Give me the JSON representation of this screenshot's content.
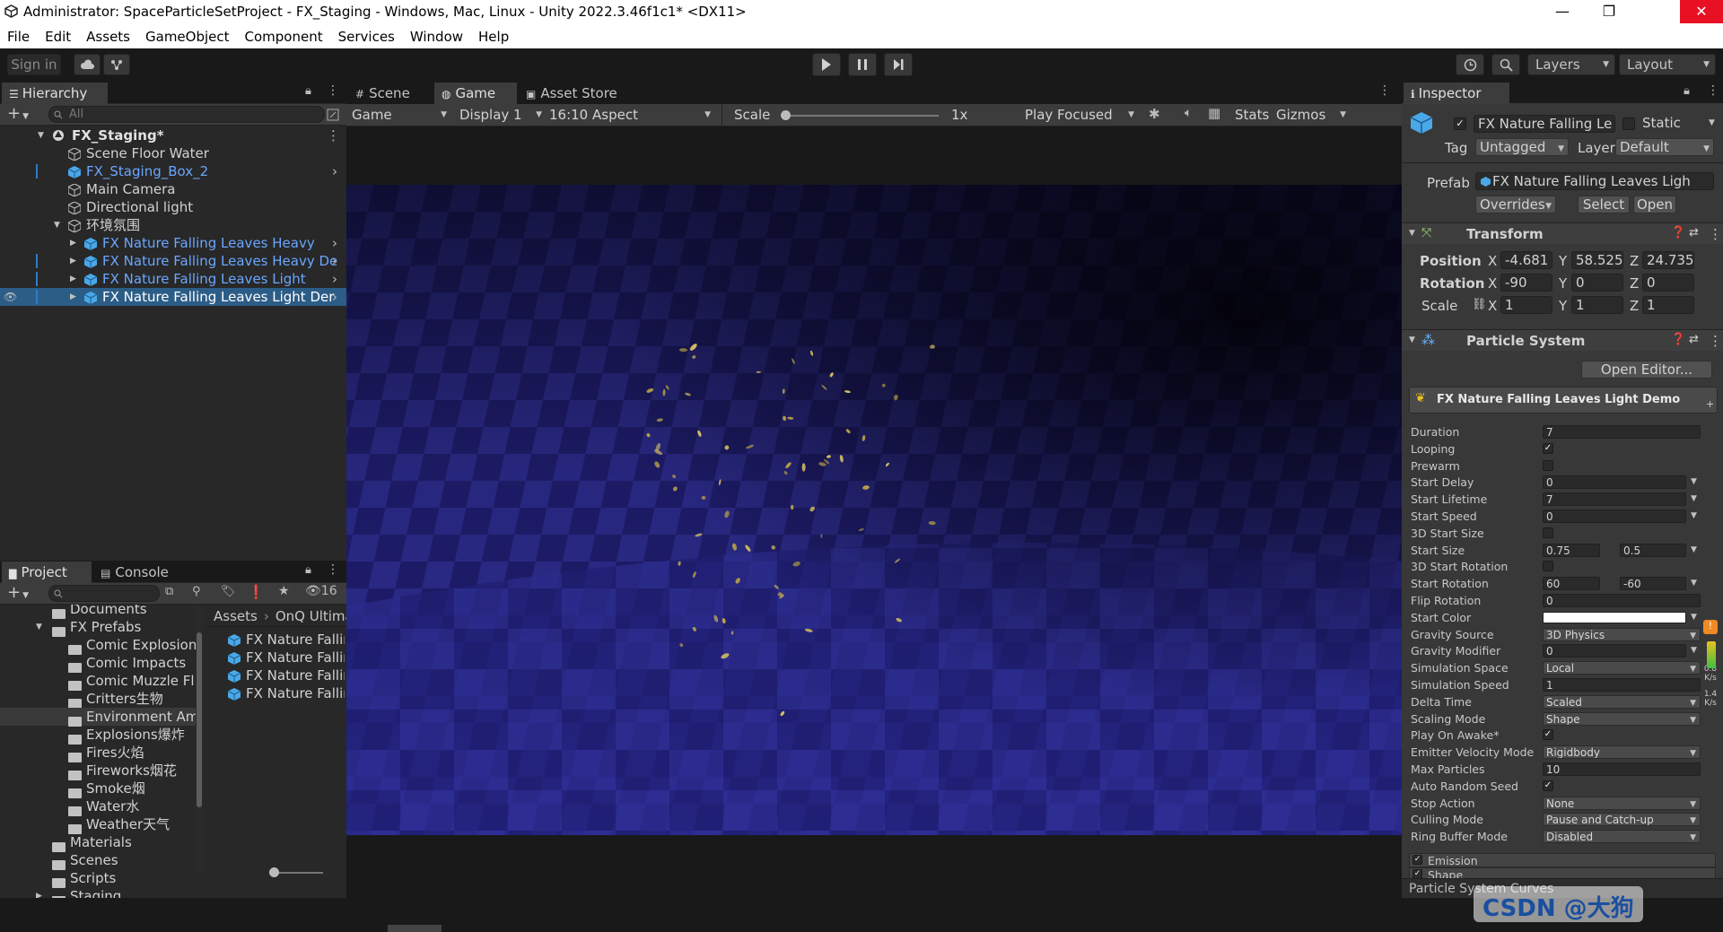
{
  "window": {
    "title": "Administrator: SpaceParticleSetProject - FX_Staging - Windows, Mac, Linux - Unity 2022.3.46f1c1* <DX11>",
    "controls": [
      "—",
      "❐",
      "✕"
    ]
  },
  "menu": [
    "File",
    "Edit",
    "Assets",
    "GameObject",
    "Component",
    "Services",
    "Window",
    "Help"
  ],
  "toolbar": {
    "sign_in": "Sign in",
    "layers": "Layers",
    "layout": "Layout"
  },
  "hierarchy": {
    "tab": "Hierarchy",
    "search_placeholder": "All",
    "scene": "FX_Staging*",
    "items": [
      {
        "label": "Scene Floor Water",
        "indent": 1
      },
      {
        "label": "FX_Staging_Box_2",
        "indent": 1
      },
      {
        "label": "Main Camera",
        "indent": 1
      },
      {
        "label": "Directional light",
        "indent": 1
      },
      {
        "label": "环境氛围",
        "indent": 1
      },
      {
        "label": "FX Nature Falling Leaves Heavy",
        "indent": 2
      },
      {
        "label": "FX Nature Falling Leaves Heavy De",
        "indent": 2
      },
      {
        "label": "FX Nature Falling Leaves Light",
        "indent": 2
      },
      {
        "label": "FX Nature Falling Leaves Light Der",
        "indent": 2
      }
    ]
  },
  "project": {
    "tabs": [
      "Project",
      "Console"
    ],
    "hidden_count": "16",
    "folders": [
      {
        "label": "Documents",
        "indent": 2
      },
      {
        "label": "FX Prefabs",
        "indent": 2
      },
      {
        "label": "Comic Explosion:",
        "indent": 3
      },
      {
        "label": "Comic Impacts",
        "indent": 3
      },
      {
        "label": "Comic Muzzle Fl",
        "indent": 3
      },
      {
        "label": "Critters生物",
        "indent": 3
      },
      {
        "label": "Environment Amt",
        "indent": 3
      },
      {
        "label": "Explosions爆炸",
        "indent": 3
      },
      {
        "label": "Fires火焰",
        "indent": 3
      },
      {
        "label": "Fireworks烟花",
        "indent": 3
      },
      {
        "label": "Smoke烟",
        "indent": 3
      },
      {
        "label": "Water水",
        "indent": 3
      },
      {
        "label": "Weather天气",
        "indent": 3
      },
      {
        "label": "Materials",
        "indent": 2
      },
      {
        "label": "Scenes",
        "indent": 2
      },
      {
        "label": "Scripts",
        "indent": 2
      },
      {
        "label": "Staging",
        "indent": 2
      }
    ],
    "breadcrumb": [
      "Assets",
      "OnQ Ultima"
    ],
    "assets": [
      "FX Nature Fallir",
      "FX Nature Fallir",
      "FX Nature Fallir",
      "FX Nature Fallir"
    ]
  },
  "center": {
    "tabs": [
      "Scene",
      "Game",
      "Asset Store"
    ],
    "game_dropdown": "Game",
    "display": "Display 1",
    "aspect": "16:10 Aspect",
    "scale_label": "Scale",
    "scale_value": "1x",
    "play_focused": "Play Focused",
    "stats": "Stats",
    "gizmos": "Gizmos"
  },
  "inspector": {
    "tab": "Inspector",
    "name": "FX Nature Falling Le",
    "static": "Static",
    "tag_label": "Tag",
    "tag": "Untagged",
    "layer_label": "Layer",
    "layer": "Default",
    "prefab_label": "Prefab",
    "prefab": "FX Nature Falling Leaves Ligh",
    "overrides": "Overrides",
    "select": "Select",
    "open": "Open",
    "transform": {
      "title": "Transform",
      "position": {
        "label": "Position",
        "x": "-4.681",
        "y": "58.525",
        "z": "24.735"
      },
      "rotation": {
        "label": "Rotation",
        "x": "-90",
        "y": "0",
        "z": "0"
      },
      "scale": {
        "label": "Scale",
        "x": "1",
        "y": "1",
        "z": "1"
      }
    },
    "particle": {
      "title": "Particle System",
      "open_editor": "Open Editor...",
      "system_name": "FX Nature Falling Leaves Light Demo",
      "props": [
        {
          "label": "Duration",
          "value": "7",
          "kind": "field"
        },
        {
          "label": "Looping",
          "value": "✓",
          "kind": "check"
        },
        {
          "label": "Prewarm",
          "value": "",
          "kind": "check"
        },
        {
          "label": "Start Delay",
          "value": "0",
          "kind": "fieldarrow"
        },
        {
          "label": "Start Lifetime",
          "value": "7",
          "kind": "fieldarrow"
        },
        {
          "label": "Start Speed",
          "value": "0",
          "kind": "fieldarrow"
        },
        {
          "label": "3D Start Size",
          "value": "",
          "kind": "check"
        },
        {
          "label": "Start Size",
          "value": "0.75",
          "value2": "0.5",
          "kind": "two"
        },
        {
          "label": "3D Start Rotation",
          "value": "",
          "kind": "check"
        },
        {
          "label": "Start Rotation",
          "value": "60",
          "value2": "-60",
          "kind": "two"
        },
        {
          "label": "Flip Rotation",
          "value": "0",
          "kind": "field"
        },
        {
          "label": "Start Color",
          "value": "",
          "kind": "color"
        },
        {
          "label": "Gravity Source",
          "value": "3D Physics",
          "kind": "drop"
        },
        {
          "label": "Gravity Modifier",
          "value": "0",
          "kind": "fieldarrow"
        },
        {
          "label": "Simulation Space",
          "value": "Local",
          "kind": "drop"
        },
        {
          "label": "Simulation Speed",
          "value": "1",
          "kind": "field"
        },
        {
          "label": "Delta Time",
          "value": "Scaled",
          "kind": "drop"
        },
        {
          "label": "Scaling Mode",
          "value": "Shape",
          "kind": "drop"
        },
        {
          "label": "Play On Awake*",
          "value": "✓",
          "kind": "check"
        },
        {
          "label": "Emitter Velocity Mode",
          "value": "Rigidbody",
          "kind": "drop"
        },
        {
          "label": "Max Particles",
          "value": "10",
          "kind": "field"
        },
        {
          "label": "Auto Random Seed",
          "value": "✓",
          "kind": "check"
        },
        {
          "label": "Stop Action",
          "value": "None",
          "kind": "drop"
        },
        {
          "label": "Culling Mode",
          "value": "Pause and Catch-up",
          "kind": "drop"
        },
        {
          "label": "Ring Buffer Mode",
          "value": "Disabled",
          "kind": "drop"
        }
      ],
      "modules": [
        "Emission",
        "Shape"
      ],
      "curves_label": "Particle System Curves"
    },
    "side_stats": [
      "0.8",
      "K/s",
      "1.4",
      "K/s"
    ]
  },
  "watermark": "CSDN @大狗"
}
